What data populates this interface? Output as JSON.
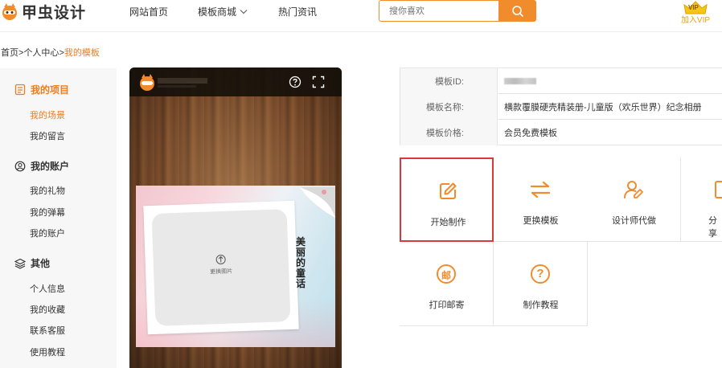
{
  "header": {
    "logo_text": "甲虫设计",
    "nav": [
      "网站首页",
      "模板商城",
      "热门资讯"
    ],
    "search_placeholder": "搜你喜欢",
    "vip_badge": "VIP",
    "vip_label": "加入VIP"
  },
  "breadcrumb": {
    "home": "首页",
    "sep": ">",
    "center": "个人中心",
    "current": "我的模板"
  },
  "sidebar": {
    "groups": [
      {
        "title": "我的项目",
        "links": [
          "我的场景",
          "我的留言"
        ]
      },
      {
        "title": "我的账户",
        "links": [
          "我的礼物",
          "我的弹幕",
          "我的账户"
        ]
      },
      {
        "title": "其他",
        "links": [
          "个人信息",
          "我的收藏",
          "联系客服",
          "使用教程"
        ]
      }
    ]
  },
  "preview": {
    "photo_label": "更换图片",
    "card_title": "美丽的童话"
  },
  "info": {
    "id_label": "模板ID:",
    "id_value": "",
    "name_label": "模板名称:",
    "name_value": "横款覆膜硬壳精装册-儿童版（欢乐世界）纪念相册",
    "price_label": "模板价格:",
    "price_value": "会员免费模板"
  },
  "actions": [
    {
      "label": "开始制作",
      "icon": "edit-icon"
    },
    {
      "label": "更换模板",
      "icon": "swap-icon"
    },
    {
      "label": "设计师代做",
      "icon": "designer-icon"
    },
    {
      "label": "分享",
      "icon": "share-icon"
    },
    {
      "label": "打印邮寄",
      "icon": "mail-icon",
      "glyph": "邮"
    },
    {
      "label": "制作教程",
      "icon": "help-icon",
      "glyph": "?"
    }
  ],
  "colors": {
    "accent": "#f08c2c",
    "text": "#333333",
    "selected_border": "#d8393b"
  }
}
